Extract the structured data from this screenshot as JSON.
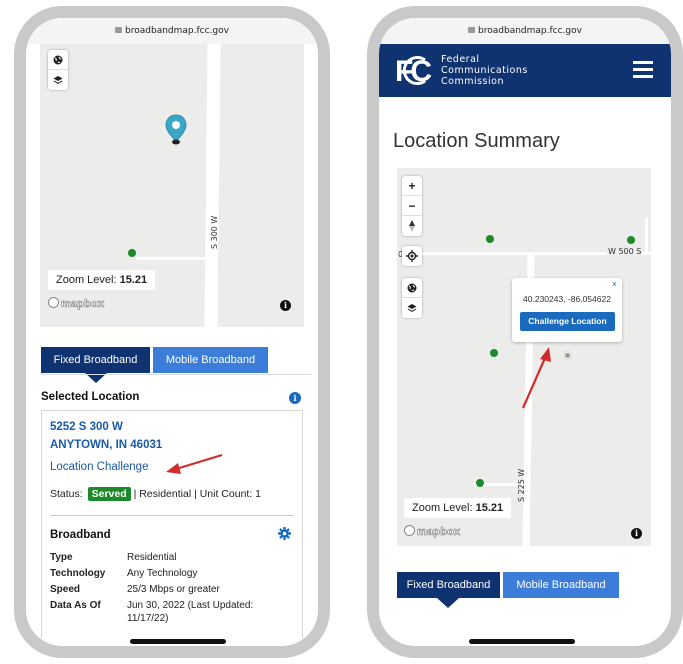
{
  "url": "broadbandmap.fcc.gov",
  "left": {
    "map": {
      "zoom_label": "Zoom Level:",
      "zoom_value": "15.21",
      "road_label": "S 300 W",
      "attribution": "mapbox"
    },
    "tabs": [
      "Fixed Broadband",
      "Mobile Broadband"
    ],
    "selected_location_heading": "Selected Location",
    "address_line1": "5252 S 300 W",
    "address_line2": "ANYTOWN, IN 46031",
    "challenge_link": "Location Challenge",
    "status_label": "Status:",
    "status_badge": "Served",
    "status_detail": "| Residential | Unit Count: 1",
    "broadband_heading": "Broadband",
    "details": [
      {
        "key": "Type",
        "value": "Residential"
      },
      {
        "key": "Technology",
        "value": "Any Technology"
      },
      {
        "key": "Speed",
        "value": "25/3 Mbps or greater"
      },
      {
        "key": "Data As Of",
        "value": "Jun 30, 2022 (Last Updated:",
        "value2": "11/17/22)"
      }
    ]
  },
  "right": {
    "org_name": [
      "Federal",
      "Communications",
      "Commission"
    ],
    "page_title": "Location Summary",
    "map": {
      "road_label_h": "W 500 S",
      "road_label_v": "S 225 W",
      "edge_label": "0",
      "coords": "40.230243, -86.054622",
      "challenge_button": "Challenge Location",
      "popup_close": "×",
      "zoom_label": "Zoom Level:",
      "zoom_value": "15.21",
      "attribution": "mapbox"
    },
    "tabs": [
      "Fixed Broadband",
      "Mobile Broadband"
    ]
  },
  "colors": {
    "fcc_blue": "#0f3270",
    "tab_inactive": "#3b7dd8",
    "link_blue": "#1a5aa8",
    "served_green": "#1a8a2a",
    "arrow_red": "#d42a2a",
    "marker_teal": "#3aa6c8"
  },
  "icons": [
    "globe-icon",
    "layers-icon",
    "info-icon",
    "settings-gear-icon",
    "plus-icon",
    "minus-icon",
    "compass-icon",
    "geolocate-icon",
    "hamburger-menu-icon",
    "map-pin-icon",
    "lock-icon"
  ]
}
